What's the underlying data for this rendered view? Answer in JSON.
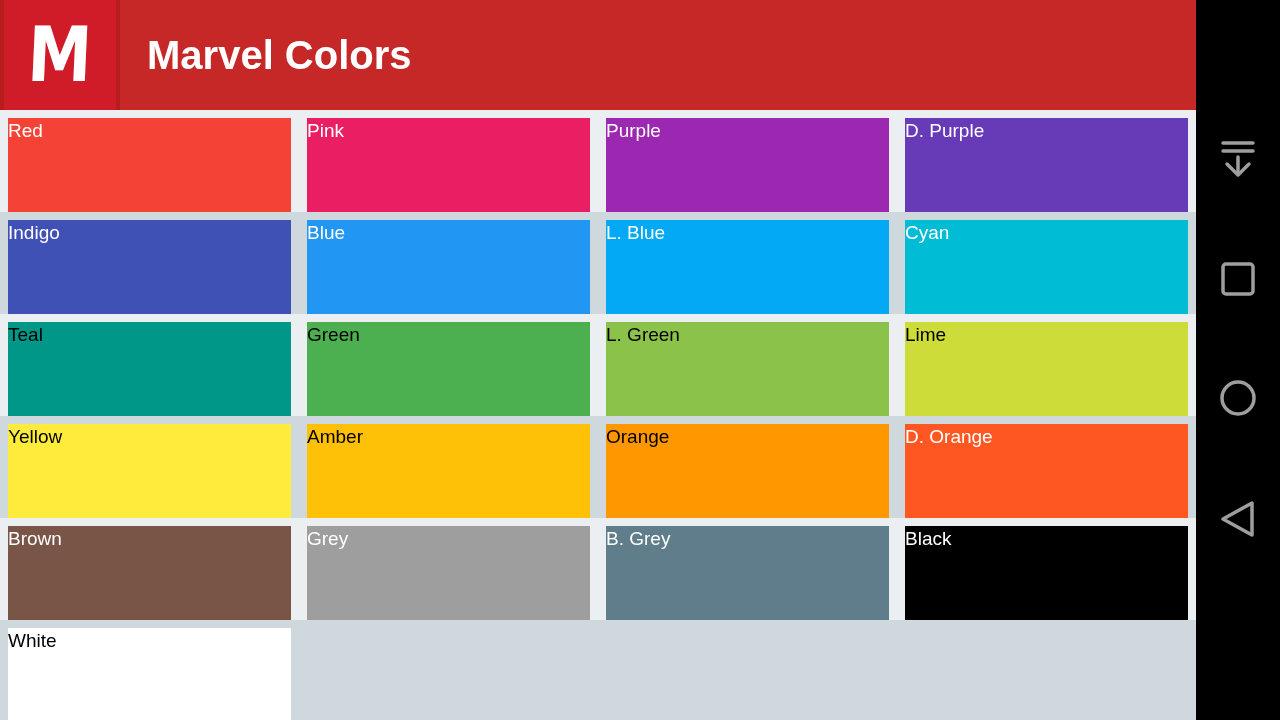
{
  "app_bar": {
    "logo_letter": "M",
    "title": "Marvel Colors"
  },
  "swatches": [
    {
      "label": "Red",
      "color": "#f44336",
      "dark_text": false
    },
    {
      "label": "Pink",
      "color": "#e91e63",
      "dark_text": false
    },
    {
      "label": "Purple",
      "color": "#9c27b0",
      "dark_text": false
    },
    {
      "label": "D. Purple",
      "color": "#673ab7",
      "dark_text": false
    },
    {
      "label": "Indigo",
      "color": "#3f51b5",
      "dark_text": false
    },
    {
      "label": "Blue",
      "color": "#2196f3",
      "dark_text": false
    },
    {
      "label": "L. Blue",
      "color": "#03a9f4",
      "dark_text": false
    },
    {
      "label": "Cyan",
      "color": "#00bcd4",
      "dark_text": false
    },
    {
      "label": "Teal",
      "color": "#009688",
      "dark_text": true
    },
    {
      "label": "Green",
      "color": "#4caf50",
      "dark_text": true
    },
    {
      "label": "L. Green",
      "color": "#8bc34a",
      "dark_text": true
    },
    {
      "label": "Lime",
      "color": "#cddc39",
      "dark_text": true
    },
    {
      "label": "Yellow",
      "color": "#ffeb3b",
      "dark_text": true
    },
    {
      "label": "Amber",
      "color": "#ffc107",
      "dark_text": true
    },
    {
      "label": "Orange",
      "color": "#ff9800",
      "dark_text": true
    },
    {
      "label": "D. Orange",
      "color": "#ff5722",
      "dark_text": false
    },
    {
      "label": "Brown",
      "color": "#795548",
      "dark_text": false
    },
    {
      "label": "Grey",
      "color": "#9e9e9e",
      "dark_text": false
    },
    {
      "label": "B. Grey",
      "color": "#607d8b",
      "dark_text": false
    },
    {
      "label": "Black",
      "color": "#000000",
      "dark_text": false
    },
    {
      "label": "White",
      "color": "#ffffff",
      "dark_text": true
    }
  ]
}
